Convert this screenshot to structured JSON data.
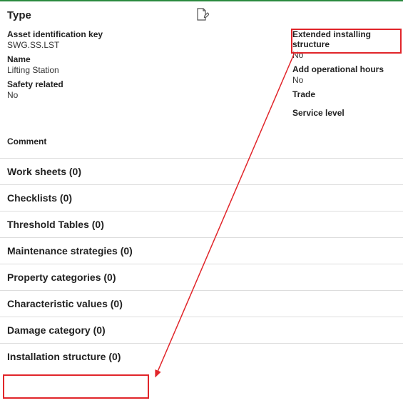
{
  "header": {
    "title": "Type"
  },
  "left": {
    "asset_key_label": "Asset identification key",
    "asset_key_value": "SWG.SS.LST",
    "name_label": "Name",
    "name_value": "Lifting Station",
    "safety_label": "Safety related",
    "safety_value": "No"
  },
  "right": {
    "ext_label": "Extended installing structure",
    "ext_value": "No",
    "hours_label": "Add operational hours",
    "hours_value": "No",
    "trade_label": "Trade",
    "service_label": "Service level"
  },
  "comment_label": "Comment",
  "sections": {
    "worksheets": "Work sheets (0)",
    "checklists": "Checklists (0)",
    "threshold": "Threshold Tables (0)",
    "maintenance": "Maintenance strategies (0)",
    "property": "Property categories (0)",
    "characteristic": "Characteristic values (0)",
    "damage": "Damage category (0)",
    "installation": "Installation structure (0)"
  }
}
